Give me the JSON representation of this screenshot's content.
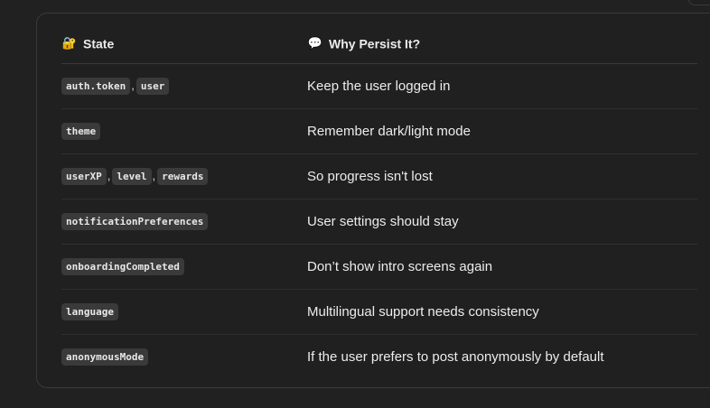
{
  "table": {
    "headers": {
      "state": {
        "icon": "🔐",
        "label": "State"
      },
      "reason": {
        "icon": "💬",
        "label": "Why Persist It?"
      }
    },
    "rows": [
      {
        "codes": [
          "auth.token",
          "user"
        ],
        "reason": "Keep the user logged in"
      },
      {
        "codes": [
          "theme"
        ],
        "reason": "Remember dark/light mode"
      },
      {
        "codes": [
          "userXP",
          "level",
          "rewards"
        ],
        "reason": "So progress isn't lost"
      },
      {
        "codes": [
          "notificationPreferences"
        ],
        "reason": "User settings should stay"
      },
      {
        "codes": [
          "onboardingCompleted"
        ],
        "reason": "Don’t show intro screens again"
      },
      {
        "codes": [
          "language"
        ],
        "reason": "Multilingual support needs consistency"
      },
      {
        "codes": [
          "anonymousMode"
        ],
        "reason": "If the user prefers to post anonymously by default"
      }
    ],
    "separator": ","
  }
}
